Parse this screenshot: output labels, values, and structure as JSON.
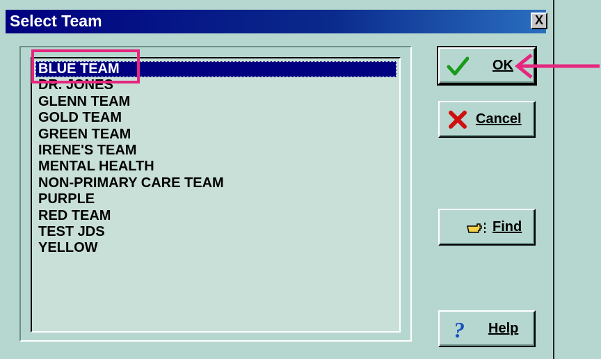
{
  "dialog": {
    "title": "Select Team",
    "close_label": "X"
  },
  "team_list": {
    "items": [
      "BLUE TEAM",
      "DR. JONES",
      "GLENN TEAM",
      "GOLD TEAM",
      "GREEN TEAM",
      "IRENE'S TEAM",
      "MENTAL HEALTH",
      "NON-PRIMARY CARE TEAM",
      "PURPLE",
      "RED TEAM",
      "TEST JDS",
      "YELLOW"
    ],
    "selected_index": 0
  },
  "buttons": {
    "ok": {
      "label": "OK",
      "icon": "checkmark-icon"
    },
    "cancel": {
      "label": "Cancel",
      "icon": "red-x-icon"
    },
    "find": {
      "label": "Find",
      "icon": "pointing-hand-icon"
    },
    "help": {
      "label": "Help",
      "icon": "question-mark-icon"
    }
  },
  "colors": {
    "title_bar": "#000080",
    "selection": "#000080",
    "dialog_bg": "#b6d7cf",
    "annotation": "#e6267f"
  }
}
